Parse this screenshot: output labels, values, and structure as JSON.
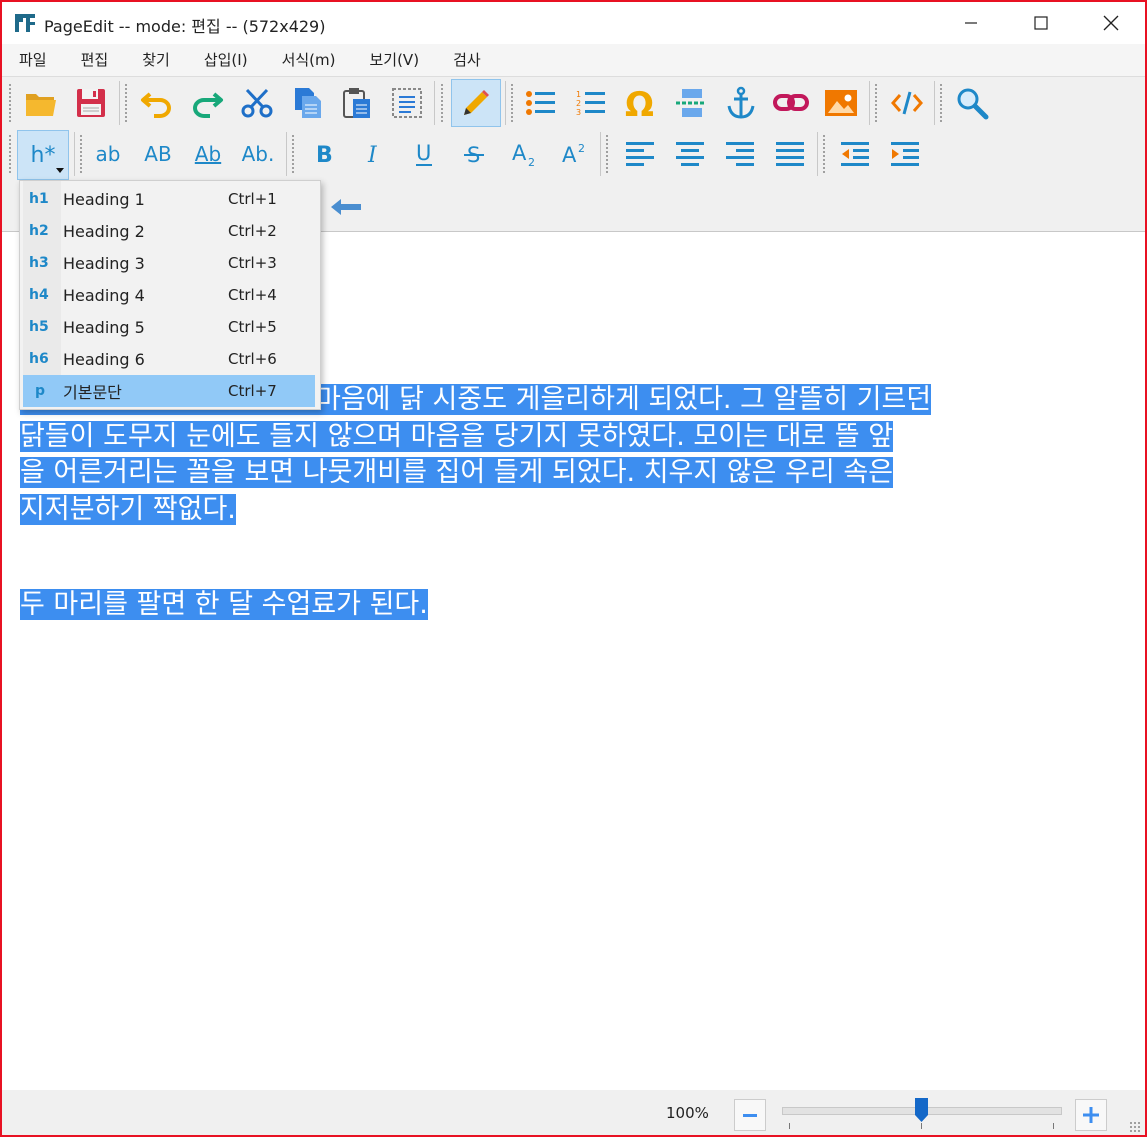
{
  "window": {
    "title": "PageEdit -- mode: 편집 -- (572x429)"
  },
  "menu": [
    "파일",
    "편집",
    "찾기",
    "삽입(I)",
    "서식(m)",
    "보기(V)",
    "검사"
  ],
  "toolbar": {
    "text_case": [
      "ab",
      "AB",
      "Ab",
      "Ab."
    ],
    "heading_button": "h*"
  },
  "heading_menu": [
    {
      "tag": "h1",
      "label": "Heading 1",
      "shortcut": "Ctrl+1"
    },
    {
      "tag": "h2",
      "label": "Heading 2",
      "shortcut": "Ctrl+2"
    },
    {
      "tag": "h3",
      "label": "Heading 3",
      "shortcut": "Ctrl+3"
    },
    {
      "tag": "h4",
      "label": "Heading 4",
      "shortcut": "Ctrl+4"
    },
    {
      "tag": "h5",
      "label": "Heading 5",
      "shortcut": "Ctrl+5"
    },
    {
      "tag": "h6",
      "label": "Heading 6",
      "shortcut": "Ctrl+6"
    },
    {
      "tag": "p",
      "label": "기본문단",
      "shortcut": "Ctrl+7"
    }
  ],
  "editor": {
    "paragraph1_lines": [
      "마음에 닭 시중도 게을리하게 되었다. 그 알뜰히 기르던",
      "닭들이 도무지 눈에도 들지 않으며 마음을 당기지 못하였다. 모이는 대로 뜰 앞",
      "을 어른거리는 꼴을 보면 나뭇개비를 집어 들게 되었다. 치우지 않은 우리 속은",
      "지저분하기 짝없다."
    ],
    "paragraph2": "두 마리를 팔면 한 달 수업료가 된다."
  },
  "status": {
    "zoom": "100%",
    "zoom_fraction": 0.5
  },
  "colors": {
    "selection": "#3d8ef0",
    "accent": "#1e88c8",
    "border": "#e81123"
  }
}
